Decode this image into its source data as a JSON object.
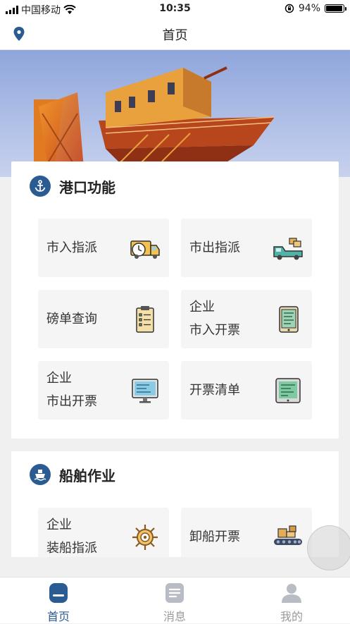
{
  "status_bar": {
    "carrier": "中国移动",
    "time": "10:35",
    "battery": "94%"
  },
  "nav": {
    "title": "首页"
  },
  "sections": [
    {
      "title": "港口功能",
      "tiles": [
        {
          "line1": "市入指派",
          "line2": "",
          "icon": "delivery-truck-clock-icon"
        },
        {
          "line1": "市出指派",
          "line2": "",
          "icon": "pickup-truck-icon"
        },
        {
          "line1": "磅单查询",
          "line2": "",
          "icon": "clipboard-icon"
        },
        {
          "line1": "企业",
          "line2": "市入开票",
          "icon": "tablet-icon"
        },
        {
          "line1": "企业",
          "line2": "市出开票",
          "icon": "monitor-icon"
        },
        {
          "line1": "开票清单",
          "line2": "",
          "icon": "ledger-screen-icon"
        }
      ]
    },
    {
      "title": "船舶作业",
      "tiles": [
        {
          "line1": "企业",
          "line2": "装船指派",
          "icon": "ship-wheel-icon"
        },
        {
          "line1": "卸船开票",
          "line2": "",
          "icon": "conveyor-boxes-icon"
        }
      ]
    }
  ],
  "tabs": [
    {
      "label": "首页",
      "icon": "home-icon",
      "active": true
    },
    {
      "label": "消息",
      "icon": "message-icon",
      "active": false
    },
    {
      "label": "我的",
      "icon": "user-icon",
      "active": false
    }
  ],
  "colors": {
    "accent": "#2a5b93",
    "tile_bg": "#f5f5f5"
  }
}
